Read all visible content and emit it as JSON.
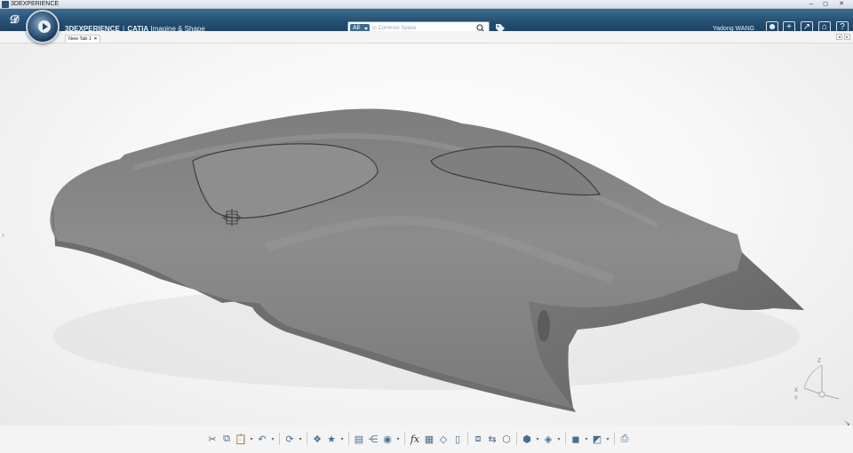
{
  "window": {
    "title": "3DEXPERIENCE",
    "controls": [
      "–",
      "◻",
      "✕"
    ]
  },
  "header": {
    "brand_main": "3DEXPERIENCE",
    "brand_sep": "|",
    "brand_product": "CATIA",
    "brand_app": "Imagine & Shape",
    "search_scope": "All",
    "search_placeholder": "in Common Space",
    "user_name": "Yadong WANG"
  },
  "tabs": [
    {
      "label": "New Tab 1",
      "close": "×"
    }
  ],
  "tab_nav": {
    "prev": "◂",
    "next": "▸"
  },
  "compass": {
    "axis_x": "X",
    "axis_y": "Y",
    "axis_z": "Z"
  },
  "toolbar": {
    "icons": [
      "cut-icon",
      "copy-icon",
      "paste-icon",
      "undo-icon",
      "update-icon",
      "catalog-icon",
      "favorite-icon",
      "properties-icon",
      "tree-icon",
      "sphere-icon",
      "formula-icon",
      "table-icon",
      "measure-icon",
      "cylinder-icon",
      "sketch-icon",
      "axis-system-icon",
      "multi-view-icon",
      "view-selector-icon",
      "render-style-icon",
      "cube-view-icon",
      "hide-show-icon",
      "capture-icon"
    ]
  },
  "colors": {
    "header_bg": "#234e72",
    "model_gray": "#8a8a8a",
    "viewport_bg": "#f7f7f7"
  }
}
